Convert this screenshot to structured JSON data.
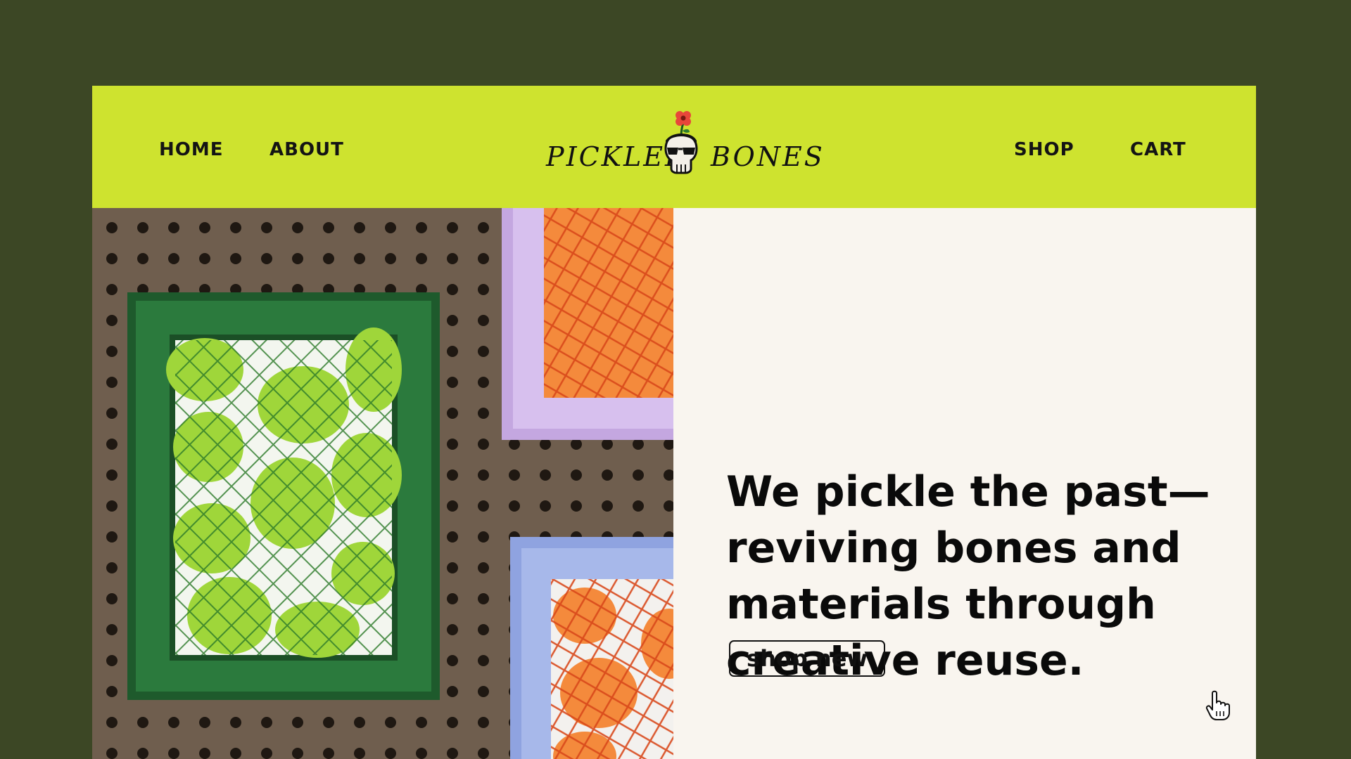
{
  "nav": {
    "home_label": "HOME",
    "about_label": "ABOUT",
    "shop_label": "SHOP",
    "cart_label": "CART"
  },
  "logo": {
    "word_left": "PICKLED",
    "word_right": "BONES"
  },
  "hero": {
    "headline": "We pickle the past—reviving bones and materials through creative reuse.",
    "cta_label": "shop new",
    "image_icon": "picture-frames-on-pegboard"
  },
  "colors": {
    "background": "#3c4725",
    "header": "#cee32f",
    "content": "#f9f5ef",
    "text": "#0a0a0a",
    "accent_flower": "#e8473a"
  }
}
